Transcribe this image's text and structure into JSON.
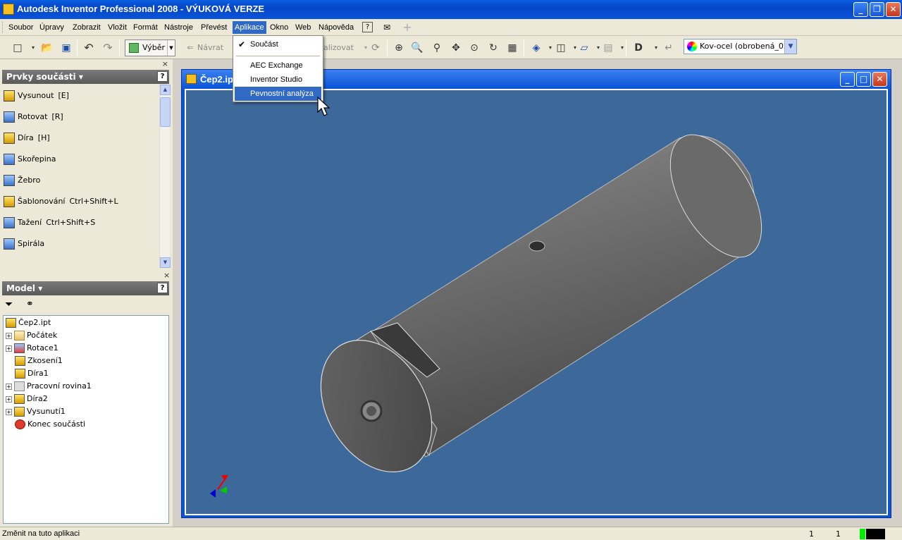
{
  "window": {
    "title": "Autodesk Inventor Professional 2008 - VÝUKOVÁ VERZE"
  },
  "menubar": {
    "items": [
      "Soubor",
      "Úpravy",
      "Zobrazit",
      "Vložit",
      "Formát",
      "Nástroje",
      "Převést",
      "Aplikace",
      "Okno",
      "Web",
      "Nápověda"
    ],
    "active": "Aplikace"
  },
  "toolbar": {
    "select_label": "Výběr",
    "undo_text": "Návrat",
    "analyze_text": "alizovat",
    "material": "Kov-ocel (obrobená_02)"
  },
  "aplikace_menu": {
    "items": [
      {
        "label": "Součást",
        "checked": true
      },
      {
        "label": "AEC Exchange",
        "checked": false
      },
      {
        "label": "Inventor Studio",
        "checked": false
      },
      {
        "label": "Pevnostní analýza",
        "checked": false,
        "highlighted": true
      }
    ]
  },
  "features_panel": {
    "title": "Prvky součásti ▾",
    "items": [
      {
        "label": "Vysunout",
        "shortcut": "[E]"
      },
      {
        "label": "Rotovat",
        "shortcut": "[R]"
      },
      {
        "label": "Díra",
        "shortcut": "[H]"
      },
      {
        "label": "Skořepina",
        "shortcut": ""
      },
      {
        "label": "Žebro",
        "shortcut": ""
      },
      {
        "label": "Šablonování",
        "shortcut": "Ctrl+Shift+L"
      },
      {
        "label": "Tažení",
        "shortcut": "Ctrl+Shift+S"
      },
      {
        "label": "Spirála",
        "shortcut": ""
      }
    ]
  },
  "model_panel": {
    "title": "Model ▾",
    "tree": [
      {
        "label": "Čep2.ipt",
        "expandable": false,
        "icon": "part"
      },
      {
        "label": "Počátek",
        "expandable": true,
        "icon": "folder"
      },
      {
        "label": "Rotace1",
        "expandable": true,
        "icon": "revolve"
      },
      {
        "label": "Zkosení1",
        "expandable": false,
        "icon": "chamfer"
      },
      {
        "label": "Díra1",
        "expandable": false,
        "icon": "hole"
      },
      {
        "label": "Pracovní rovina1",
        "expandable": true,
        "icon": "plane"
      },
      {
        "label": "Díra2",
        "expandable": true,
        "icon": "hole"
      },
      {
        "label": "Vysunutí1",
        "expandable": true,
        "icon": "extrude"
      },
      {
        "label": "Konec součásti",
        "expandable": false,
        "icon": "end"
      }
    ]
  },
  "document": {
    "title": "Čep2.ipt"
  },
  "statusbar": {
    "message": "Změnit na tuto aplikaci",
    "cell1": "1",
    "cell2": "1"
  },
  "colors": {
    "viewport_bg": "#3c689a",
    "menu_highlight": "#316ac5",
    "titlebar": "#0a54d8"
  }
}
